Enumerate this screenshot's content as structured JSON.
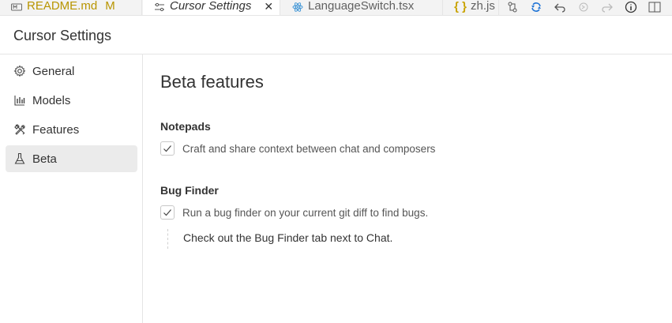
{
  "tabs": [
    {
      "label": "README.md",
      "status": "M",
      "icon": "markdown-icon"
    },
    {
      "label": "Cursor Settings",
      "icon": "settings-sliders-icon",
      "close": "✕"
    },
    {
      "label": "LanguageSwitch.tsx",
      "icon": "react-icon"
    },
    {
      "label": "zh.js",
      "icon": "json-braces-icon",
      "icon_text": "{ }"
    }
  ],
  "toolbar": [
    "compare-icon",
    "sync-icon",
    "go-back-icon",
    "go-forward-icon",
    "forward-disabled-icon",
    "info-icon",
    "split-editor-icon"
  ],
  "header": {
    "title": "Cursor Settings"
  },
  "sidebar": {
    "items": [
      {
        "label": "General",
        "icon": "gear-icon"
      },
      {
        "label": "Models",
        "icon": "bar-chart-icon"
      },
      {
        "label": "Features",
        "icon": "tools-icon"
      },
      {
        "label": "Beta",
        "icon": "flask-icon",
        "active": true
      }
    ]
  },
  "main": {
    "title": "Beta features",
    "sections": [
      {
        "title": "Notepads",
        "checkbox_label": "Craft and share context between chat and composers",
        "checked": true
      },
      {
        "title": "Bug Finder",
        "checkbox_label": "Run a bug finder on your current git diff to find bugs.",
        "checked": true,
        "note": "Check out the Bug Finder tab next to Chat."
      }
    ]
  },
  "colors": {
    "modified": "#b89500",
    "active_bg": "#ebebeb",
    "border": "#e5e5e5",
    "accent_blue": "#0078d4"
  }
}
